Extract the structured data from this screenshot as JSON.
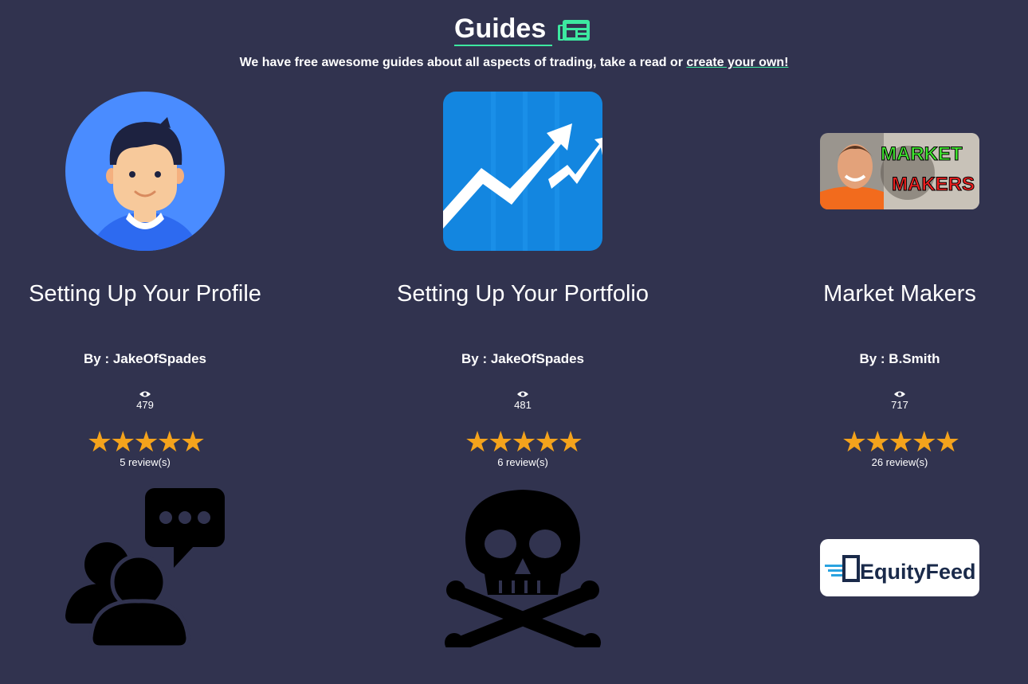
{
  "header": {
    "title": "Guides",
    "title_icon": "newspaper-icon",
    "subtitle_text": "We have free awesome guides about all aspects of trading, take a read or ",
    "subtitle_link": "create your own!"
  },
  "colors": {
    "background": "#31334f",
    "accent": "#3de8a0",
    "star": "#f4a31c"
  },
  "guides": [
    {
      "title": "Setting Up Your Profile",
      "author": "By : JakeOfSpades",
      "views": "479",
      "rating": 5,
      "reviews": "5 review(s)",
      "image": "profile-avatar-image"
    },
    {
      "title": "Setting Up Your Portfolio",
      "author": "By : JakeOfSpades",
      "views": "481",
      "rating": 5,
      "reviews": "6 review(s)",
      "image": "trending-chart-image"
    },
    {
      "title": "Market Makers",
      "author": "By : B.Smith",
      "views": "717",
      "rating": 5,
      "reviews": "26 review(s)",
      "image": "market-makers-thumbnail",
      "image_text": [
        "MARKET",
        "MAKERS"
      ]
    },
    {
      "image": "community-chat-image"
    },
    {
      "image": "skull-crossbones-image"
    },
    {
      "image": "equityfeed-logo-image",
      "image_text": [
        "EquityFeed"
      ]
    }
  ],
  "star_char": "★★★★★"
}
